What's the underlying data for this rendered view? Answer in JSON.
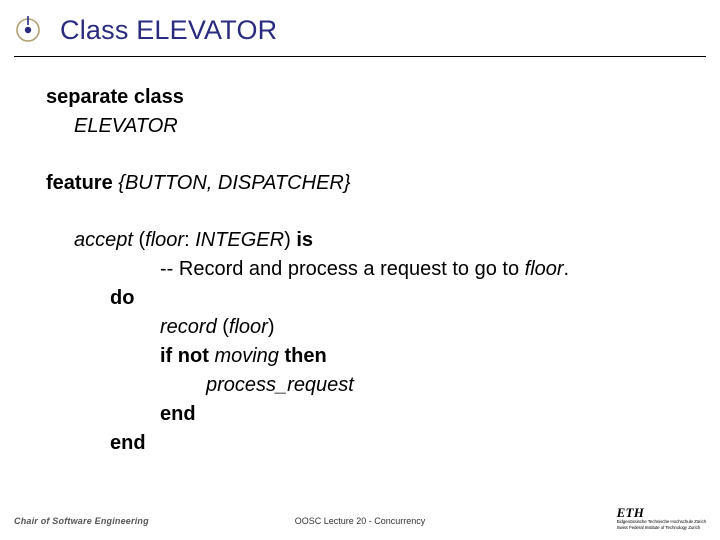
{
  "title": "Class ELEVATOR",
  "code": {
    "separate": "separate class",
    "classname": "ELEVATOR",
    "feature_kw": "feature",
    "feature_clients": " {BUTTON, DISPATCHER}",
    "accept": "accept",
    "accept_sig_open": " (",
    "floor": "floor",
    "accept_sig_mid": ": ",
    "integer": "INTEGER",
    "accept_sig_close": ") ",
    "is": "is",
    "comment_pre": "-- Record and process a request to go to ",
    "comment_floor": "floor",
    "comment_post": ".",
    "do": "do",
    "record": "record",
    "record_args_open": " (",
    "record_arg": "floor",
    "record_args_close": ")",
    "if": "if",
    "not": " not ",
    "moving": "moving",
    "then": " then",
    "process_request": "process_request",
    "end1": "end",
    "end2": "end"
  },
  "footer": {
    "left": "Chair of Software Engineering",
    "center": "OOSC  Lecture 20 - Concurrency",
    "eth": "ETH",
    "eth_sub1": "Eidgenössische Technische Hochschule Zürich",
    "eth_sub2": "Swiss Federal Institute of Technology Zurich"
  }
}
